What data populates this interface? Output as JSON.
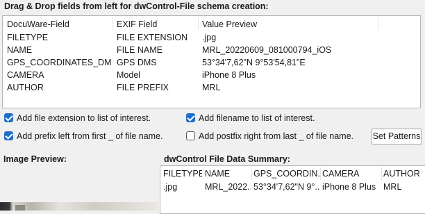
{
  "schema_heading": "Drag & Drop fields from left for dwControl-File schema creation:",
  "mapping_table": {
    "columns": [
      "DocuWare-Field",
      "EXIF Field",
      "Value Preview"
    ],
    "rows": [
      [
        "FILETYPE",
        "FILE EXTENSION",
        ".jpg"
      ],
      [
        "NAME",
        "FILE NAME",
        "MRL_20220609_081000794_iOS"
      ],
      [
        "GPS_COORDINATES_DMS",
        "GPS DMS",
        "53°34'7,62\"N 9°53'54,81\"E"
      ],
      [
        "CAMERA",
        "Model",
        "iPhone 8 Plus"
      ],
      [
        "AUTHOR",
        "FILE PREFIX",
        "MRL"
      ]
    ]
  },
  "options": {
    "add_extension": {
      "label": "Add file extension to list of interest.",
      "checked": true
    },
    "add_filename": {
      "label": "Add filename to list of interest.",
      "checked": true
    },
    "add_prefix": {
      "label": "Add prefix left from first _ of file name.",
      "checked": true
    },
    "add_postfix": {
      "label": "Add postfix right from last _ of file name.",
      "checked": false
    }
  },
  "set_patterns_label": "Set Patterns",
  "image_preview_heading": "Image Preview:",
  "summary_heading": "dwControl File Data Summary:",
  "summary_table": {
    "columns": [
      "FILETYPE",
      "NAME",
      "GPS_COORDIN...",
      "CAMERA",
      "AUTHOR"
    ],
    "rows": [
      [
        ".jpg",
        "MRL_2022...",
        "53°34'7,62\"N 9°...",
        "iPhone 8 Plus",
        "MRL"
      ]
    ]
  },
  "colors": {
    "checkbox_accent": "#1f6fc8",
    "window_bg": "#f0f0f0",
    "list_bg": "#ffffff"
  }
}
